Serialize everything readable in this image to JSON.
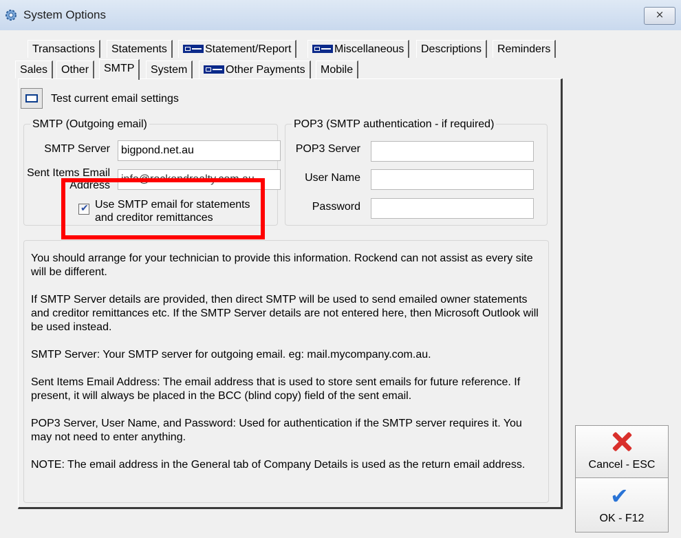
{
  "window": {
    "title": "System Options",
    "close_glyph": "⨯"
  },
  "tabs": {
    "row1": [
      {
        "label": "Transactions",
        "icon": null
      },
      {
        "label": "Statements",
        "icon": null
      },
      {
        "label": "Statement/Report",
        "icon": "key-icon"
      },
      {
        "label": "Miscellaneous",
        "icon": "key-icon"
      },
      {
        "label": "Descriptions",
        "icon": null
      },
      {
        "label": "Reminders",
        "icon": null
      }
    ],
    "row2": [
      {
        "label": "Sales",
        "icon": null
      },
      {
        "label": "Other",
        "icon": null
      },
      {
        "label": "SMTP",
        "icon": null,
        "active": true
      },
      {
        "label": "System",
        "icon": null
      },
      {
        "label": "Other Payments",
        "icon": "key-icon"
      },
      {
        "label": "Mobile",
        "icon": null
      }
    ]
  },
  "test": {
    "label": "Test current email settings"
  },
  "smtp": {
    "group_title": "SMTP (Outgoing email)",
    "server_label": "SMTP Server",
    "server_value": "bigpond.net.au",
    "sent_label_line1": "Sent Items Email",
    "sent_label_line2": "Address",
    "sent_value": "info@rockendrealty.com.au",
    "checkbox_checked": true,
    "checkbox_line1": "Use SMTP email for statements",
    "checkbox_line2": "and creditor remittances"
  },
  "pop3": {
    "group_title": "POP3 (SMTP authentication - if required)",
    "server_label": "POP3 Server",
    "server_value": "",
    "user_label": "User Name",
    "user_value": "",
    "password_label": "Password",
    "password_value": ""
  },
  "info": {
    "p1": "You should arrange for your technician to provide this information. Rockend can not assist as every site will be different.",
    "p2": "If SMTP Server details are provided, then direct SMTP will be used to send emailed owner statements and creditor remittances etc. If the SMTP Server details are not entered here, then Microsoft Outlook will be used instead.",
    "p3": "SMTP Server: Your SMTP server for outgoing email. eg: mail.mycompany.com.au.",
    "p4": "Sent Items Email Address: The email address that is used to store sent emails for future reference. If present, it will always be placed in the BCC (blind copy) field of the sent email.",
    "p5": "POP3 Server, User Name, and Password: Used for authentication if the SMTP server requires it. You may not need to enter anything.",
    "p6": "NOTE: The email address in the General tab of Company Details is used as the return email address."
  },
  "buttons": {
    "cancel": "Cancel - ESC",
    "ok": "OK - F12"
  },
  "colors": {
    "highlight_box": "#ff0000",
    "cancel_icon": "#d9302c",
    "ok_icon": "#2a74d6"
  }
}
